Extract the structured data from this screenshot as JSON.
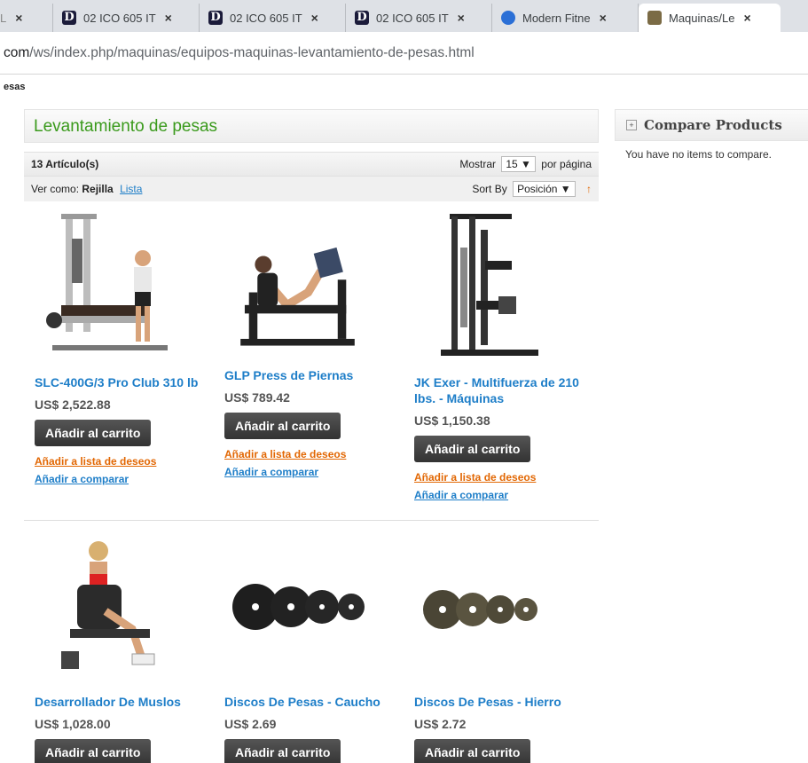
{
  "browser": {
    "tabs": [
      {
        "title": "L",
        "icon": "generic-tab-icon"
      },
      {
        "title": "02 ICO 605 IT",
        "icon": "d-logo-icon"
      },
      {
        "title": "02 ICO 605 IT",
        "icon": "d-logo-icon"
      },
      {
        "title": "02 ICO 605 IT",
        "icon": "d-logo-icon"
      },
      {
        "title": "Modern Fitne",
        "icon": "modern-fitness-icon"
      },
      {
        "title": "Maquinas/Le",
        "icon": "image-favicon-icon"
      }
    ],
    "close_glyph": "×",
    "url_host": "com",
    "url_path": "/ws/index.php/maquinas/equipos-maquinas-levantamiento-de-pesas.html"
  },
  "breadcrumb": "esas",
  "category": {
    "title": "Levantamiento de pesas",
    "count_label": "13 Artículo(s)",
    "show_label": "Mostrar",
    "show_value": "15 ▼",
    "per_page_label": "por página",
    "view_as_label": "Ver como:",
    "view_grid": "Rejilla",
    "view_list": "Lista",
    "sort_by_label": "Sort By",
    "sort_value": "Posición ▼",
    "sort_arrow": "↑"
  },
  "products": [
    {
      "name": "SLC-400G/3 Pro Club 310 lb",
      "price": "US$ 2,522.88",
      "cart": "Añadir al carrito",
      "wishlist": "Añadir a lista de deseos",
      "compare": "Añadir a comparar",
      "image": "leg-curl-machine"
    },
    {
      "name": "GLP Press de Piernas",
      "price": "US$ 789.42",
      "cart": "Añadir al carrito",
      "wishlist": "Añadir a lista de deseos",
      "compare": "Añadir a comparar",
      "image": "leg-press"
    },
    {
      "name": "JK Exer - Multifuerza de 210 lbs. - Máquinas",
      "price": "US$ 1,150.38",
      "cart": "Añadir al carrito",
      "wishlist": "Añadir a lista de deseos",
      "compare": "Añadir a comparar",
      "image": "multi-gym"
    },
    {
      "name": "Desarrollador De Muslos",
      "price": "US$ 1,028.00",
      "cart": "Añadir al carrito",
      "image": "thigh-machine"
    },
    {
      "name": "Discos De Pesas - Caucho",
      "price": "US$ 2.69",
      "cart": "Añadir al carrito",
      "image": "rubber-plates"
    },
    {
      "name": "Discos De Pesas - Hierro",
      "price": "US$ 2.72",
      "cart": "Añadir al carrito",
      "image": "iron-plates"
    }
  ],
  "sidebar": {
    "compare_title": "Compare Products",
    "compare_empty": "You have no items to compare.",
    "icon_glyph": "+"
  }
}
